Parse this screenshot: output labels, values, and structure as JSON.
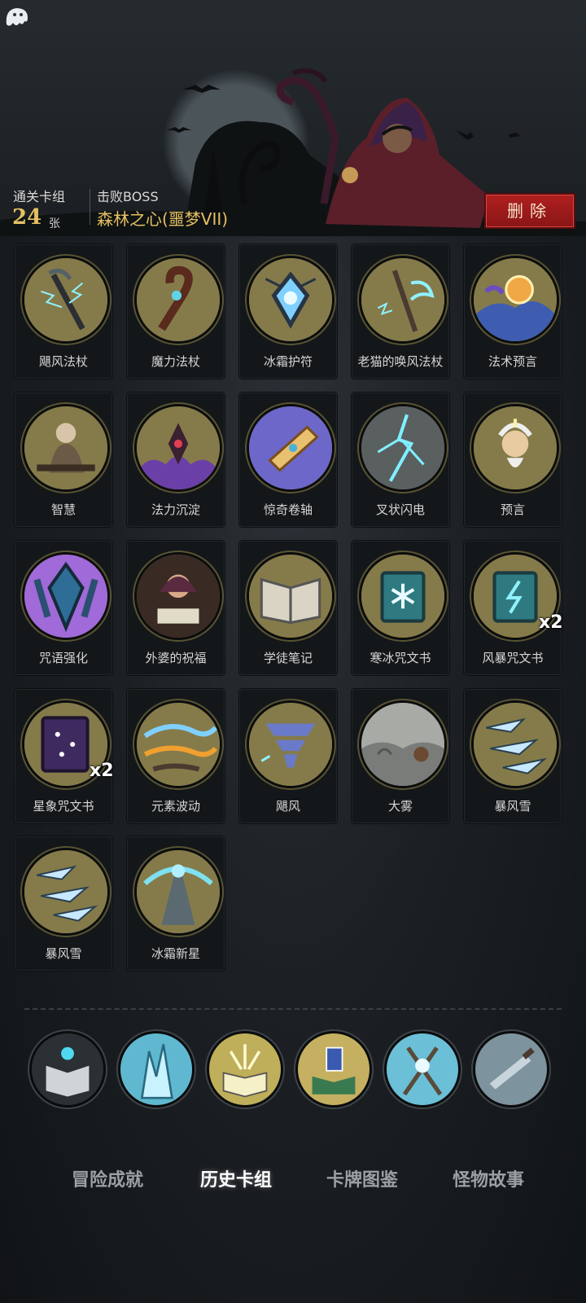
{
  "header": {
    "deck_label": "通关卡组",
    "deck_count": "24",
    "deck_unit": "张",
    "boss_label": "击败BOSS",
    "boss_name": "森林之心(噩梦VII)",
    "delete_label": "删除"
  },
  "cards": [
    {
      "name": "飓风法杖",
      "icon": "staff-lightning-icon"
    },
    {
      "name": "魔力法杖",
      "icon": "wooden-staff-icon"
    },
    {
      "name": "冰霜护符",
      "icon": "frost-amulet-icon"
    },
    {
      "name": "老猫的唤风法杖",
      "icon": "wind-staff-icon"
    },
    {
      "name": "法术预言",
      "icon": "crystal-ball-icon"
    },
    {
      "name": "智慧",
      "icon": "old-sage-icon"
    },
    {
      "name": "法力沉淀",
      "icon": "mana-eye-icon"
    },
    {
      "name": "惊奇卷轴",
      "icon": "scroll-icon"
    },
    {
      "name": "叉状闪电",
      "icon": "forked-lightning-icon"
    },
    {
      "name": "预言",
      "icon": "prophet-icon"
    },
    {
      "name": "咒语强化",
      "icon": "rune-crystal-icon"
    },
    {
      "name": "外婆的祝福",
      "icon": "grandma-icon"
    },
    {
      "name": "学徒笔记",
      "icon": "open-book-icon"
    },
    {
      "name": "寒冰咒文书",
      "icon": "ice-tome-icon"
    },
    {
      "name": "风暴咒文书",
      "icon": "storm-tome-icon",
      "count": "x2"
    },
    {
      "name": "星象咒文书",
      "icon": "star-tome-icon",
      "count": "x2"
    },
    {
      "name": "元素波动",
      "icon": "element-wave-icon"
    },
    {
      "name": "飓风",
      "icon": "tornado-icon"
    },
    {
      "name": "大雾",
      "icon": "fog-icon"
    },
    {
      "name": "暴风雪",
      "icon": "blizzard-icon"
    },
    {
      "name": "暴风雪",
      "icon": "blizzard-icon"
    },
    {
      "name": "冰霜新星",
      "icon": "frost-nova-icon"
    }
  ],
  "relics": [
    {
      "icon": "spellbook-lamp-icon"
    },
    {
      "icon": "ice-crystal-icon"
    },
    {
      "icon": "glowing-book-icon"
    },
    {
      "icon": "card-book-icon"
    },
    {
      "icon": "crossed-staves-icon"
    },
    {
      "icon": "dagger-icon"
    }
  ],
  "tabs": [
    {
      "label": "冒险成就",
      "active": false
    },
    {
      "label": "历史卡组",
      "active": true
    },
    {
      "label": "卡牌图鉴",
      "active": false
    },
    {
      "label": "怪物故事",
      "active": false
    }
  ],
  "colors": {
    "accent_gold": "#e4c063",
    "delete_red": "#a81c1c",
    "card_art": "#857b4a"
  }
}
